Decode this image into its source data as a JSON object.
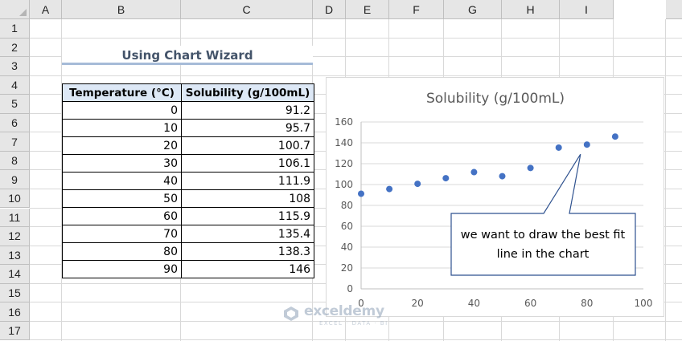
{
  "sheet": {
    "columns": [
      "A",
      "B",
      "C",
      "D",
      "E",
      "F",
      "G",
      "H",
      "I"
    ],
    "rows": [
      "1",
      "2",
      "3",
      "4",
      "5",
      "6",
      "7",
      "8",
      "9",
      "10",
      "11",
      "12",
      "13",
      "14",
      "15",
      "16",
      "17"
    ]
  },
  "title": "Using Chart Wizard",
  "table": {
    "headers": [
      "Temperature (°C)",
      "Solubility (g/100mL)"
    ],
    "rows": [
      [
        "0",
        "91.2"
      ],
      [
        "10",
        "95.7"
      ],
      [
        "20",
        "100.7"
      ],
      [
        "30",
        "106.1"
      ],
      [
        "40",
        "111.9"
      ],
      [
        "50",
        "108"
      ],
      [
        "60",
        "115.9"
      ],
      [
        "70",
        "135.4"
      ],
      [
        "80",
        "138.3"
      ],
      [
        "90",
        "146"
      ]
    ]
  },
  "chart_data": {
    "type": "scatter",
    "title": "Solubility (g/100mL)",
    "xlabel": "",
    "ylabel": "",
    "xlim": [
      0,
      100
    ],
    "ylim": [
      0,
      160
    ],
    "xticks": [
      "0",
      "20",
      "40",
      "60",
      "80",
      "100"
    ],
    "yticks": [
      "0",
      "20",
      "40",
      "60",
      "80",
      "100",
      "120",
      "140",
      "160"
    ],
    "grid": "horizontal",
    "series": [
      {
        "x": [
          0,
          10,
          20,
          30,
          40,
          50,
          60,
          70,
          80,
          90
        ],
        "y": [
          91.2,
          95.7,
          100.7,
          106.1,
          111.9,
          108,
          115.9,
          135.4,
          138.3,
          146
        ]
      }
    ],
    "marker_color": "#4472c4"
  },
  "callout": {
    "text": "we want to draw the best fit line in the chart"
  },
  "watermark": {
    "name": "exceldemy",
    "sub": "EXCEL · DATA · BI"
  }
}
